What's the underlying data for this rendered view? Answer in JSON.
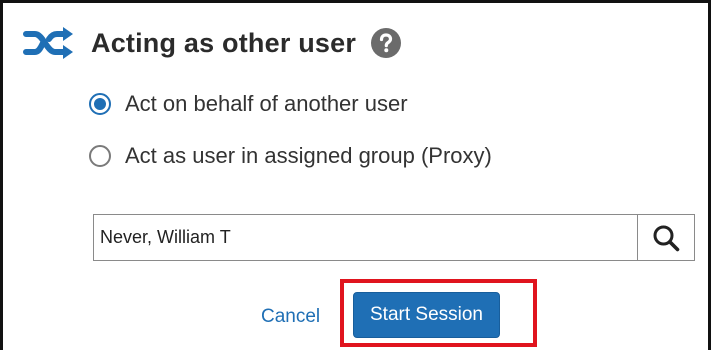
{
  "dialog": {
    "title": "Acting as other user",
    "title_icon": "shuffle-icon",
    "help_icon": "help-icon"
  },
  "options": [
    {
      "label": "Act on behalf of another user",
      "checked": true
    },
    {
      "label": "Act as user in assigned group (Proxy)",
      "checked": false
    }
  ],
  "search": {
    "value": "Never, William T",
    "button_icon": "search-icon"
  },
  "actions": {
    "cancel_label": "Cancel",
    "start_label": "Start Session"
  },
  "colors": {
    "accent": "#1f6fb5",
    "highlight": "#e0141e"
  }
}
